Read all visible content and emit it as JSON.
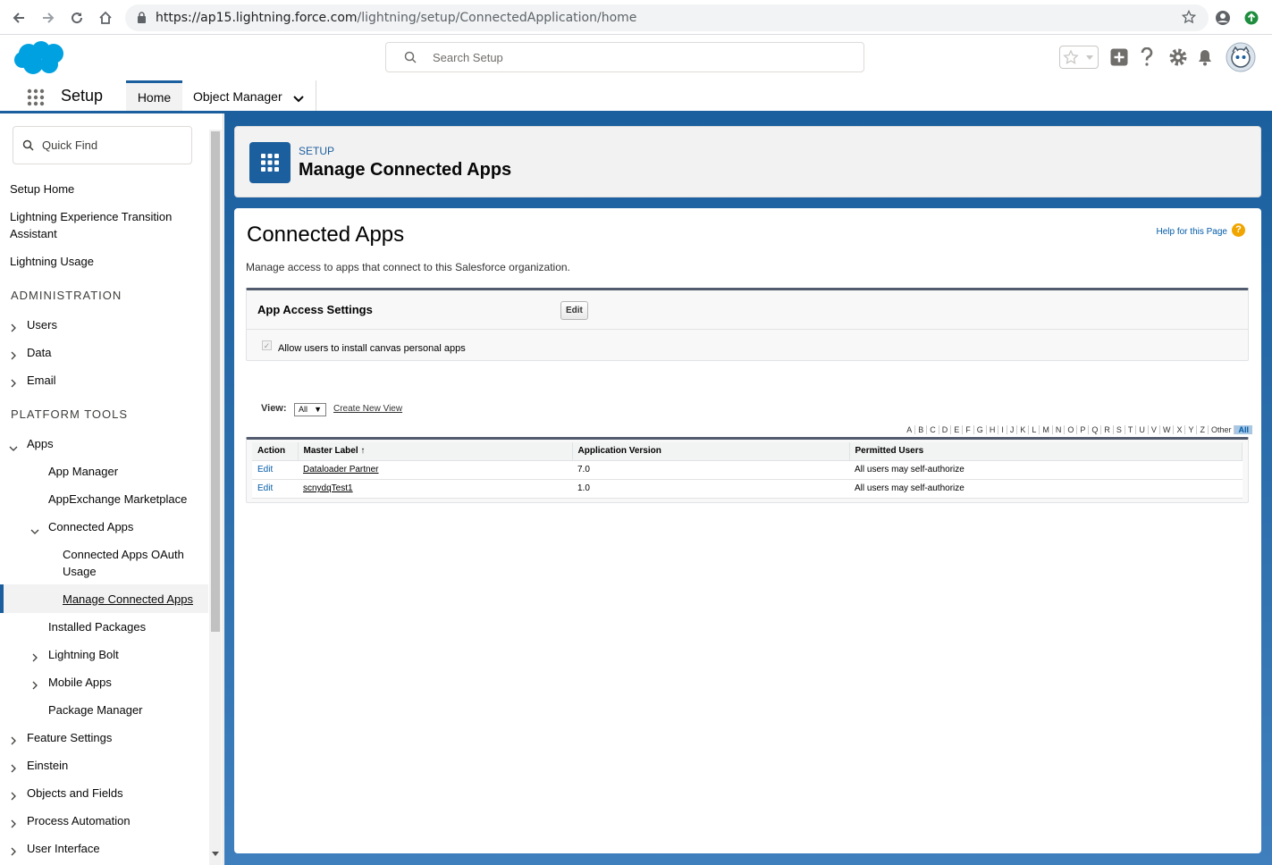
{
  "browser": {
    "url_host": "https://ap15.lightning.force.com",
    "url_path": "/lightning/setup/ConnectedApplication/home"
  },
  "header": {
    "search_placeholder": "Search Setup",
    "colors": {
      "brand": "#00a1e0",
      "accent": "#1b5f9e"
    }
  },
  "nav": {
    "app_title": "Setup",
    "tabs": [
      {
        "label": "Home"
      },
      {
        "label": "Object Manager"
      }
    ]
  },
  "sidebar": {
    "quick_find_placeholder": "Quick Find",
    "items": [
      {
        "label": "Setup Home"
      },
      {
        "label": "Lightning Experience Transition Assistant"
      },
      {
        "label": "Lightning Usage"
      }
    ],
    "administration": {
      "heading": "ADMINISTRATION",
      "items": [
        "Users",
        "Data",
        "Email"
      ]
    },
    "platform_tools": {
      "heading": "PLATFORM TOOLS",
      "apps": "Apps",
      "app_manager": "App Manager",
      "appexchange": "AppExchange Marketplace",
      "connected_apps": "Connected Apps",
      "oauth_usage": "Connected Apps OAuth Usage",
      "manage_connected_apps": "Manage Connected Apps",
      "installed_packages": "Installed Packages",
      "lightning_bolt": "Lightning Bolt",
      "mobile_apps": "Mobile Apps",
      "package_manager": "Package Manager",
      "feature_settings": "Feature Settings",
      "einstein": "Einstein",
      "objects_fields": "Objects and Fields",
      "process_automation": "Process Automation",
      "user_interface": "User Interface"
    }
  },
  "page_header": {
    "breadcrumb": "SETUP",
    "title": "Manage Connected Apps"
  },
  "content": {
    "heading": "Connected Apps",
    "help_link": "Help for this Page",
    "description": "Manage access to apps that connect to this Salesforce organization.",
    "access": {
      "title": "App Access Settings",
      "edit_label": "Edit",
      "checkbox_label": "Allow users to install canvas personal apps",
      "checkbox_checked": true
    },
    "view": {
      "label": "View:",
      "selected": "All",
      "create_new_view": "Create New View"
    },
    "alpha_filter": [
      "A",
      "B",
      "C",
      "D",
      "E",
      "F",
      "G",
      "H",
      "I",
      "J",
      "K",
      "L",
      "M",
      "N",
      "O",
      "P",
      "Q",
      "R",
      "S",
      "T",
      "U",
      "V",
      "W",
      "X",
      "Y",
      "Z",
      "Other",
      "All"
    ],
    "alpha_selected": "All",
    "table": {
      "columns": [
        "Action",
        "Master Label ↑",
        "Application Version",
        "Permitted Users"
      ],
      "rows": [
        {
          "action": "Edit",
          "label": "Dataloader Partner",
          "version": "7.0",
          "users": "All users may self-authorize"
        },
        {
          "action": "Edit",
          "label": "scnydqTest1",
          "version": "1.0",
          "users": "All users may self-authorize"
        }
      ]
    }
  }
}
